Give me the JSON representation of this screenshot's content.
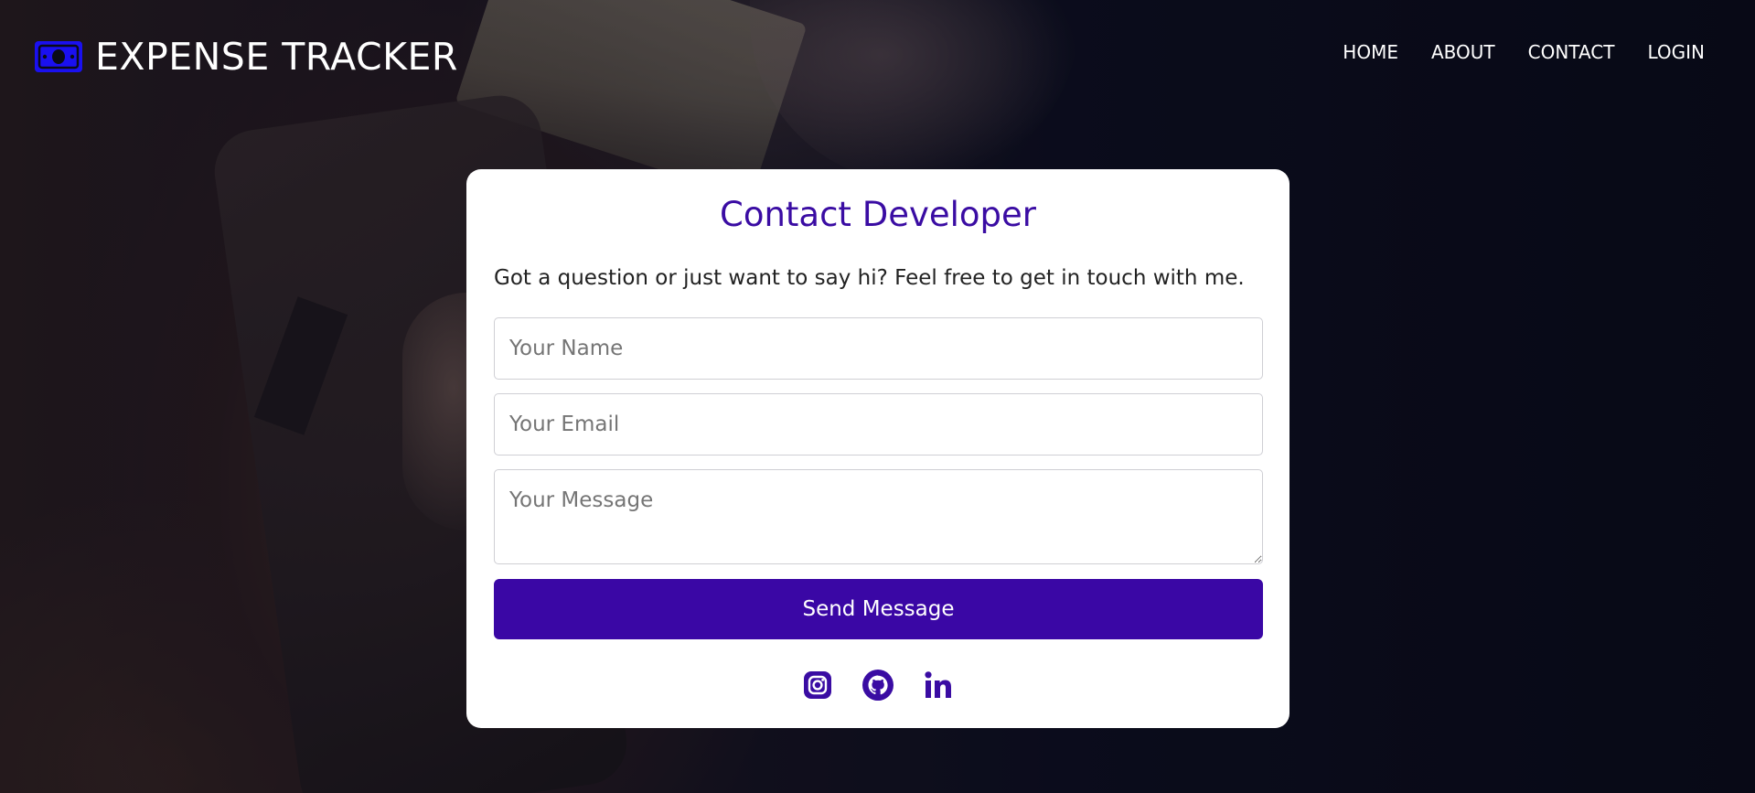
{
  "header": {
    "brand_title": "EXPENSE TRACKER",
    "brand_icon": "money-bill-icon",
    "brand_color": "#1a10f0",
    "nav": [
      {
        "label": "HOME"
      },
      {
        "label": "ABOUT"
      },
      {
        "label": "CONTACT"
      },
      {
        "label": "LOGIN"
      }
    ]
  },
  "contact": {
    "title": "Contact Developer",
    "subtitle": "Got a question or just want to say hi? Feel free to get in touch with me.",
    "name_placeholder": "Your Name",
    "email_placeholder": "Your Email",
    "message_placeholder": "Your Message",
    "send_label": "Send Message",
    "accent_color": "#3a0ca3",
    "socials": [
      {
        "icon": "instagram-icon"
      },
      {
        "icon": "github-icon"
      },
      {
        "icon": "linkedin-icon"
      }
    ]
  }
}
